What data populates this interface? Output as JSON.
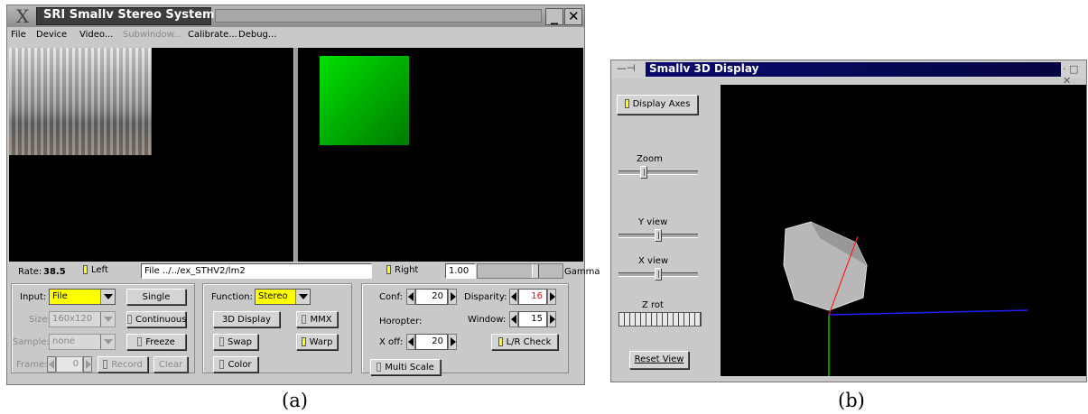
{
  "window_a": {
    "title": "SRI Smallv Stereo System",
    "logo_glyph": "X",
    "minimize_glyph": "_",
    "close_glyph": "✕",
    "menu": [
      "File",
      "Device",
      "Video...",
      "Subwindow...",
      "Calibrate...",
      "Debug..."
    ],
    "status": {
      "rate_label": "Rate:",
      "rate_value": "38.5",
      "left_label": "Left",
      "file_path": "File ../../ex_STHV2/lm2",
      "right_label": "Right",
      "gamma_value": "1.00",
      "gamma_label": "Gamma"
    },
    "input_panel": {
      "input_label": "Input:",
      "input_value": "File",
      "single_label": "Single",
      "size_label": "Size:",
      "size_value": "160x120",
      "continuous_label": "Continuous",
      "sample_label": "Sample:",
      "sample_value": "none",
      "freeze_label": "Freeze",
      "frame_label": "Frame:",
      "frame_value": "0",
      "record_label": "Record",
      "clear_label": "Clear"
    },
    "function_panel": {
      "function_label": "Function:",
      "function_value": "Stereo",
      "display3d_label": "3D Display",
      "mmx_label": "MMX",
      "swap_label": "Swap",
      "warp_label": "Warp",
      "color_label": "Color"
    },
    "stereo_panel": {
      "conf_label": "Conf:",
      "conf_value": "20",
      "disparity_label": "Disparity:",
      "disparity_value": "16",
      "horopter_label": "Horopter:",
      "window_label": "Window:",
      "window_value": "15",
      "xoff_label": "X off:",
      "xoff_value": "20",
      "lrcheck_label": "L/R Check",
      "multiscale_label": "Multi Scale"
    }
  },
  "window_b": {
    "title": "Smallv 3D Display",
    "controls_glyph": "· □ ✕",
    "display_axes_label": "Display Axes",
    "zoom_label": "Zoom",
    "zoom_level": 0.3,
    "yview_label": "Y view",
    "yview_level": 0.5,
    "xview_label": "X view",
    "xview_level": 0.5,
    "zrot_label": "Z rot",
    "reset_label": "Reset View"
  },
  "captions": {
    "a": "(a)",
    "b": "(b)"
  },
  "colors": {
    "indicator_on": "#ffff00",
    "disparity_value": "#ff0000",
    "title_bar_b": "#0a0a6e"
  }
}
